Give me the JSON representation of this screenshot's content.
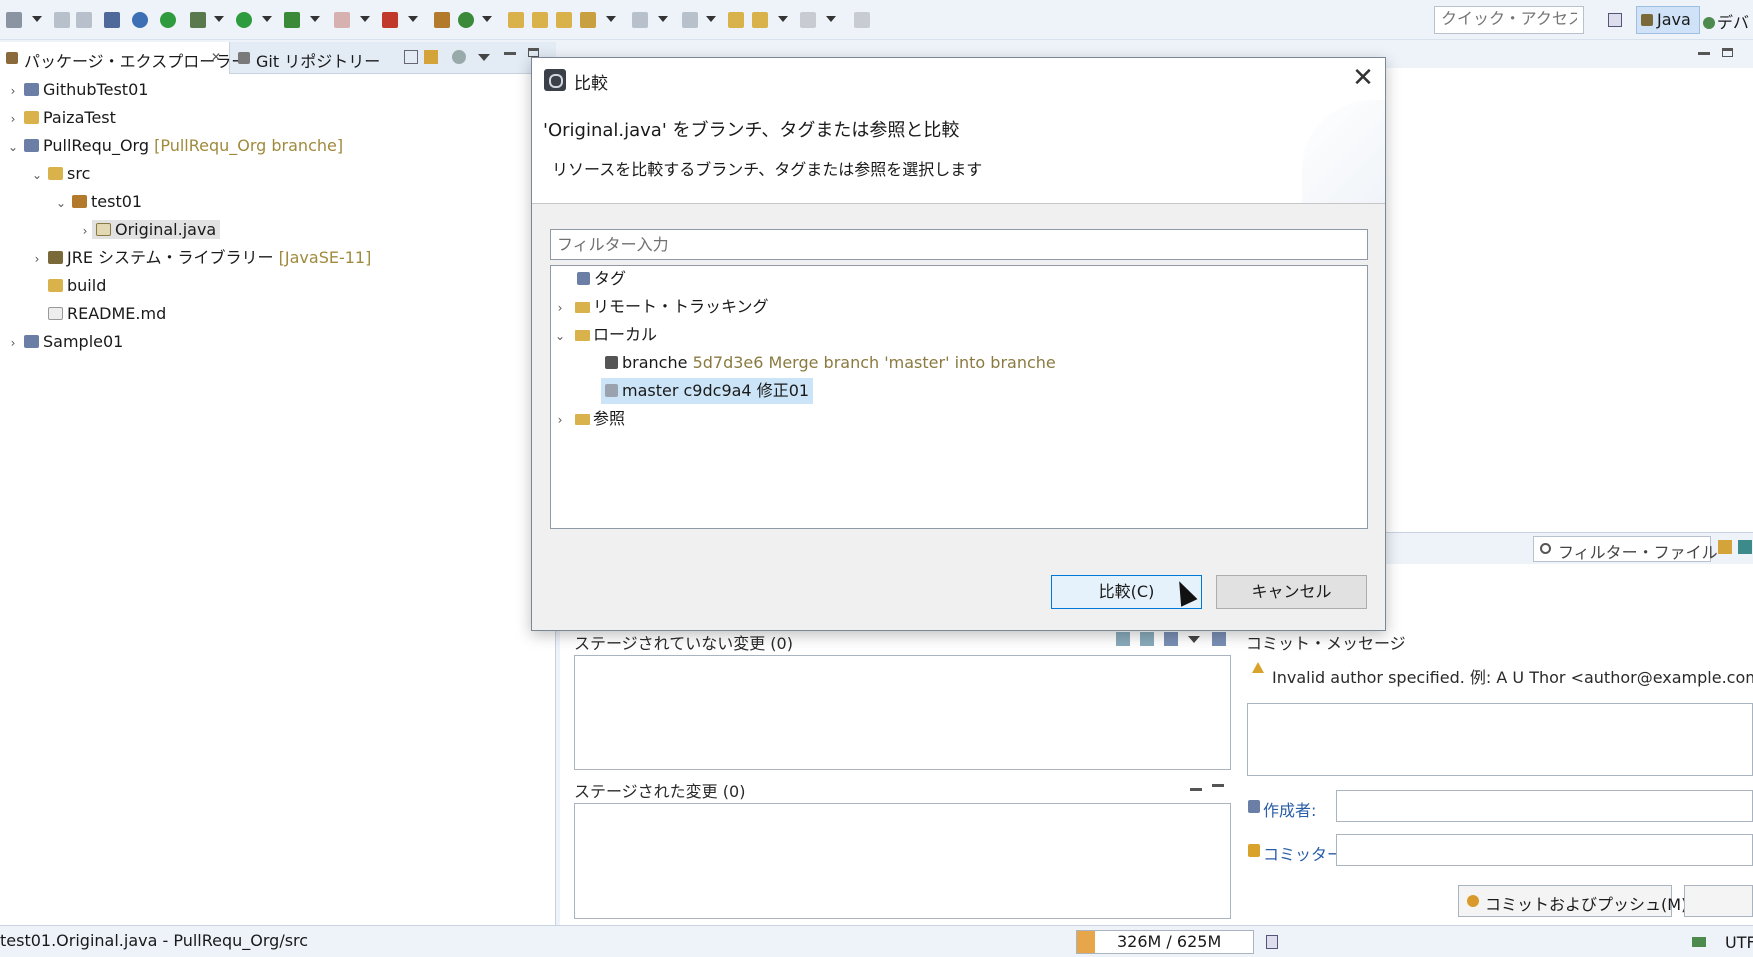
{
  "toolbar": {
    "quick_access_placeholder": "クイック・アクセス",
    "perspective_java": "Java",
    "perspective_debug": "デバ"
  },
  "explorer": {
    "tabs": [
      {
        "label": "パッケージ・エクスプローラー",
        "active": true
      },
      {
        "label": "Git リポジトリー",
        "active": false
      }
    ],
    "tree": [
      {
        "label": "GithubTest01",
        "decoration": "",
        "depth": 0,
        "expanded": false
      },
      {
        "label": "PaizaTest",
        "decoration": "",
        "depth": 0,
        "expanded": false
      },
      {
        "label": "PullRequ_Org",
        "decoration": "[PullRequ_Org branche]",
        "depth": 0,
        "expanded": true
      },
      {
        "label": "src",
        "decoration": "",
        "depth": 1,
        "expanded": true
      },
      {
        "label": "test01",
        "decoration": "",
        "depth": 2,
        "expanded": true
      },
      {
        "label": "Original.java",
        "decoration": "",
        "depth": 3,
        "expanded": false,
        "selected": true
      },
      {
        "label": "JRE システム・ライブラリー",
        "decoration": "[JavaSE-11]",
        "depth": 1,
        "expanded": false
      },
      {
        "label": "build",
        "decoration": "",
        "depth": 1
      },
      {
        "label": "README.md",
        "decoration": "",
        "depth": 1
      },
      {
        "label": "Sample01",
        "decoration": "",
        "depth": 0,
        "expanded": false
      }
    ]
  },
  "staging": {
    "filter_placeholder": "フィルター・ファイル",
    "unstaged_title": "ステージされていない変更 (0)",
    "staged_title": "ステージされた変更 (0)",
    "commit_message_title": "コミット・メッセージ",
    "warning": "Invalid author specified. 例: A U Thor <author@example.com>",
    "author_label": "作成者:",
    "committer_label": "コミッター:",
    "commit_push_label": "コミットおよびプッシュ(M)..."
  },
  "statusbar": {
    "path": "test01.Original.java - PullRequ_Org/src",
    "heap": "326M / 625M",
    "heap_fraction": 0.52,
    "encoding": "UTF"
  },
  "dialog": {
    "title": "比較",
    "heading": "'Original.java' をブランチ、タグまたは参照と比較",
    "description": "リソースを比較するブランチ、タグまたは参照を選択します",
    "filter_placeholder": "フィルター入力",
    "tree": {
      "tags": "タグ",
      "remote": "リモート・トラッキング",
      "local": "ローカル",
      "branche_name": "branche",
      "branche_info": "5d7d3e6 Merge branch 'master' into branche",
      "master_label": "master c9dc9a4 修正01",
      "refs": "参照"
    },
    "compare_button": "比較(C)",
    "cancel_button": "キャンセル"
  },
  "colors": {
    "selection": "#cce4f7",
    "decoration": "#a08a3c",
    "accent": "#0078d7"
  }
}
